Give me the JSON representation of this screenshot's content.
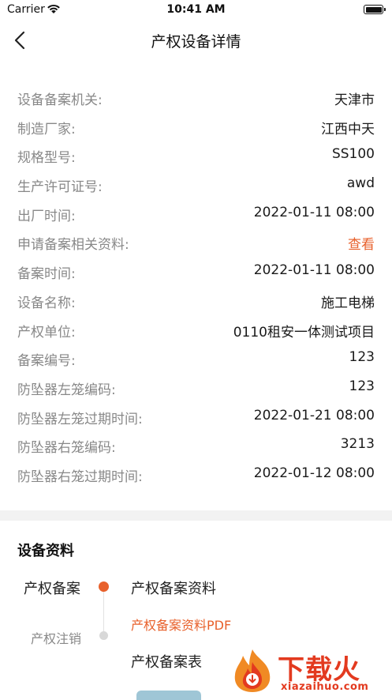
{
  "status_bar": {
    "carrier": "Carrier",
    "time": "10:41 AM"
  },
  "nav": {
    "title": "产权设备详情"
  },
  "info_rows": [
    {
      "label": "设备备案机关:",
      "value": "天津市"
    },
    {
      "label": "制造厂家:",
      "value": "江西中天"
    },
    {
      "label": "规格型号:",
      "value": "SS100"
    },
    {
      "label": "生产许可证号:",
      "value": "awd"
    },
    {
      "label": "出厂时间:",
      "value": "2022-01-11 08:00"
    },
    {
      "label": "申请备案相关资料:",
      "value": "查看"
    },
    {
      "label": "备案时间:",
      "value": "2022-01-11 08:00"
    },
    {
      "label": "设备名称:",
      "value": "施工电梯"
    },
    {
      "label": "产权单位:",
      "value": "0110租安一体测试项目"
    },
    {
      "label": "备案编号:",
      "value": "123"
    },
    {
      "label": "防坠器左笼编码:",
      "value": "123"
    },
    {
      "label": "防坠器左笼过期时间:",
      "value": "2022-01-21 08:00"
    },
    {
      "label": "防坠器右笼编码:",
      "value": "3213"
    },
    {
      "label": "防坠器右笼过期时间:",
      "value": "2022-01-12 08:00"
    }
  ],
  "docs": {
    "title": "设备资料",
    "steps": [
      {
        "label": "产权备案",
        "active": true
      },
      {
        "label": "产权注销",
        "active": false
      }
    ],
    "section_title": "产权备案资料",
    "pdf_link": "产权备案资料PDF",
    "form_item": "产权备案表"
  },
  "watermark": {
    "text": "下载火",
    "sub": "xiazaihuo.com"
  },
  "colors": {
    "accent": "#e8612c",
    "label": "#888888",
    "divider": "#f2f2f2",
    "watermark": "#e33a1f"
  }
}
